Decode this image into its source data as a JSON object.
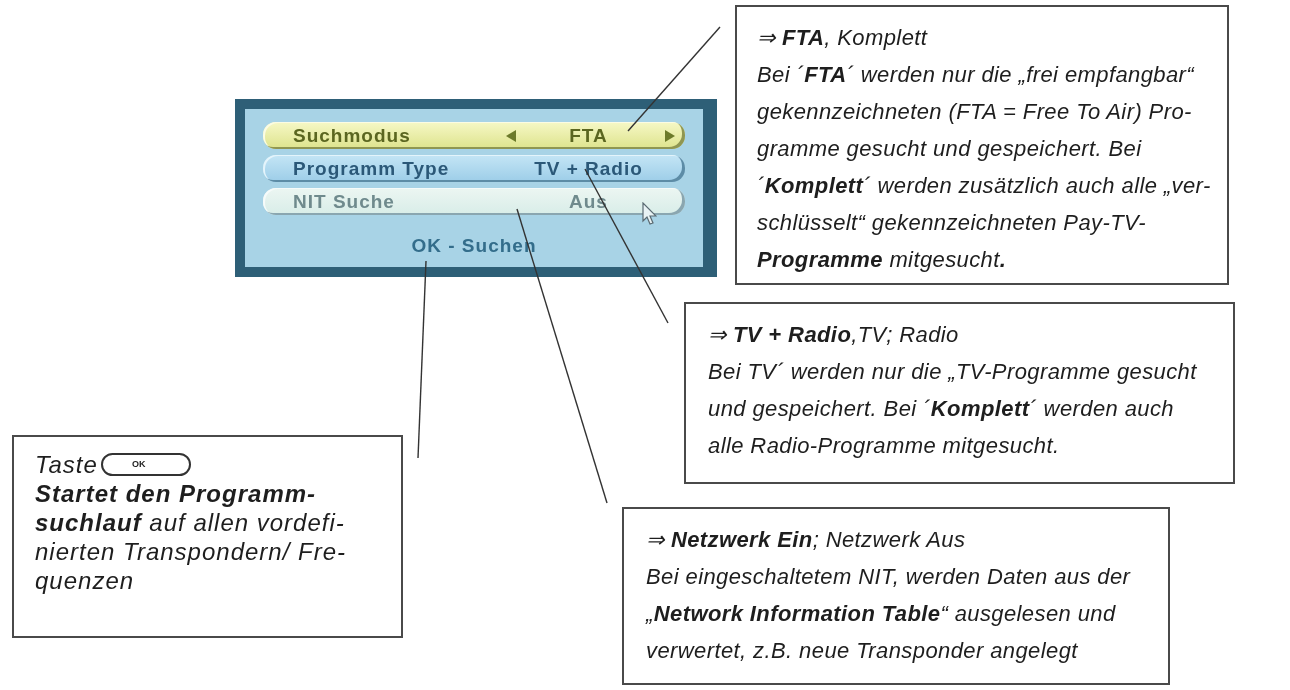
{
  "menu": {
    "rows": [
      {
        "label": "Suchmodus",
        "value": "FTA",
        "selected": true,
        "disabled": false
      },
      {
        "label": "Programm Type",
        "value": "TV + Radio",
        "selected": false,
        "disabled": false
      },
      {
        "label": "NIT Suche",
        "value": "Aus",
        "selected": false,
        "disabled": true
      }
    ],
    "footer": "OK - Suchen"
  },
  "callouts": [
    {
      "kind": "option",
      "heading": "⇒ **FTA**, Komplett",
      "text": "Bei ´**FTA**´ werden nur die „frei empfangbar“\ngekennzeichneten (FTA = Free To Air) Pro-\ngramme gesucht und gespeichert. Bei\n´**Komplett**´ werden zusätzlich auch alle „ver-\nschlüsselt“ gekennzeichneten Pay-TV-\n**Programme** mitgesucht**.**"
    },
    {
      "kind": "option",
      "heading": "⇒ **TV + Radio**,TV; Radio",
      "text": "Bei TV´ werden nur die „TV-Programme gesucht\nund gespeichert. Bei ´**Komplett**´ werden auch\nalle Radio-Programme mitgesucht."
    },
    {
      "kind": "key",
      "key_label": "Taste",
      "key": "OK",
      "text": "**Startet den Programm-**\n**suchlauf** auf allen vordefi-\nnierten Transpondern/ Fre-\nquenzen"
    },
    {
      "kind": "option",
      "heading": "⇒ **Netzwerk Ein**; Netzwerk Aus",
      "text": "Bei eingeschaltetem NIT, werden Daten aus der\n„**Network Information Table**“ ausgelesen und\nverwertet, z.B. neue Transponder angelegt"
    }
  ]
}
